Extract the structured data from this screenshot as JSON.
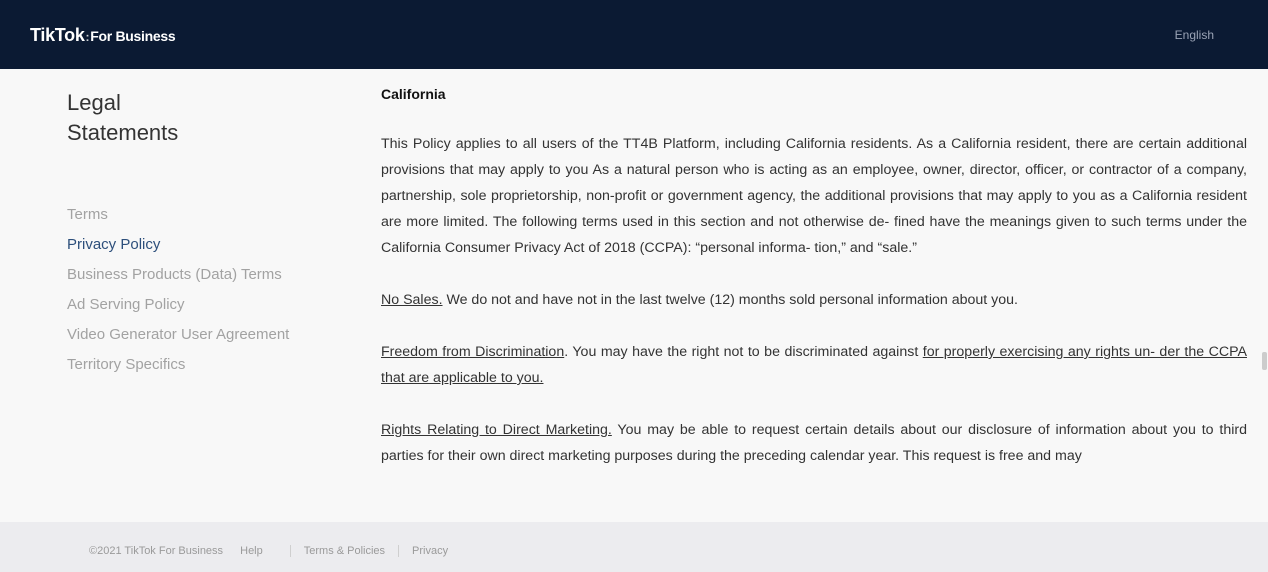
{
  "header": {
    "logo_main": "TikTok",
    "logo_sep": ":",
    "logo_sub": "For Business",
    "language": "English"
  },
  "sidebar": {
    "title_line1": "Legal",
    "title_line2": "Statements",
    "items": [
      {
        "label": "Terms"
      },
      {
        "label": "Privacy Policy",
        "active": true
      },
      {
        "label": "Business Products (Data) Terms"
      },
      {
        "label": "Ad Serving Policy"
      },
      {
        "label": "Video Generator User Agreement"
      },
      {
        "label": "Territory Specifics"
      }
    ]
  },
  "content": {
    "heading": "California",
    "p1": "This Policy applies to all users of the TT4B Platform, including California residents. As a California resident, there are certain additional provisions that may apply to you As a natural person who is acting as an employee, owner, director, officer, or contractor of a company, partnership, sole proprietorship, non-profit or government agency, the additional provisions that may apply to you as a California resident are more limited. The following terms used in this section and not otherwise de- fined have the meanings given to such terms under the California Consumer Privacy Act of 2018 (CCPA): “personal informa- tion,” and “sale.”",
    "p2_link": "No Sales.",
    "p2_text": " We do not and have not in the last twelve (12) months sold personal information about you.",
    "p3_link": "Freedom from Discrimination",
    "p3_text": ". You may have the right not to be discriminated against ",
    "p3_link2": "for properly exercising any rights un- der the CCPA that are applicable to you.",
    "p4_link": "Rights Relating to Direct Marketing.",
    "p4_text": " You may be able to request certain details about our disclosure of information about you to third parties for their own direct marketing purposes during the preceding calendar year. This request is free and may"
  },
  "footer": {
    "copyright": "©2021 TikTok For Business",
    "help": "Help",
    "terms": "Terms & Policies",
    "privacy": "Privacy"
  }
}
